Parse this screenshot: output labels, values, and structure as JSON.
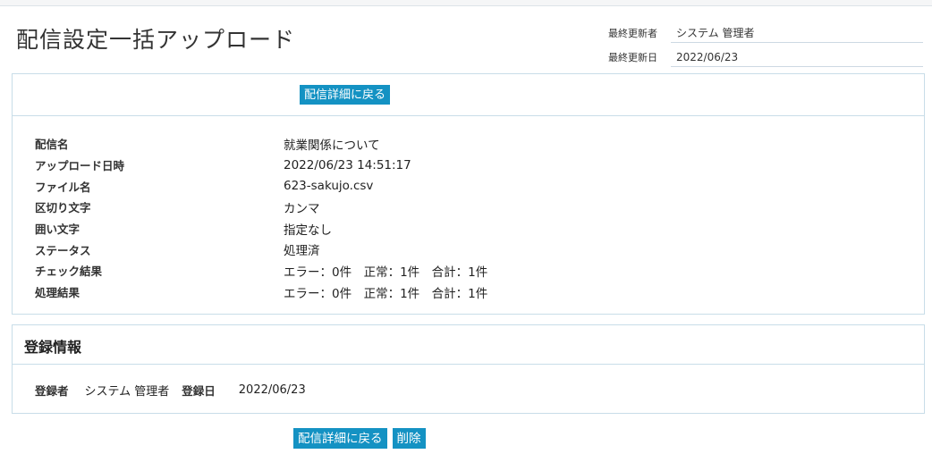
{
  "header": {
    "title": "配信設定一括アップロード",
    "last_updated_by_label": "最終更新者",
    "last_updated_by": "システム 管理者",
    "last_updated_date_label": "最終更新日",
    "last_updated_date": "2022/06/23"
  },
  "actions": {
    "back_label": "配信詳細に戻る",
    "delete_label": "削除"
  },
  "details": [
    {
      "label": "配信名",
      "value": "就業関係について"
    },
    {
      "label": "アップロード日時",
      "value": "2022/06/23 14:51:17"
    },
    {
      "label": "ファイル名",
      "value": "623-sakujo.csv"
    },
    {
      "label": "区切り文字",
      "value": "カンマ"
    },
    {
      "label": "囲い文字",
      "value": "指定なし"
    },
    {
      "label": "ステータス",
      "value": "処理済"
    },
    {
      "label": "チェック結果",
      "value": "エラー：0件　正常：1件　合計：1件"
    },
    {
      "label": "処理結果",
      "value": "エラー：0件　正常：1件　合計：1件"
    }
  ],
  "registration": {
    "title": "登録情報",
    "registrant_label": "登録者",
    "registrant": "システム 管理者",
    "registered_date_label": "登録日",
    "registered_date": "2022/06/23"
  },
  "colors": {
    "button": "#1492c3",
    "border": "#c8dde8"
  }
}
